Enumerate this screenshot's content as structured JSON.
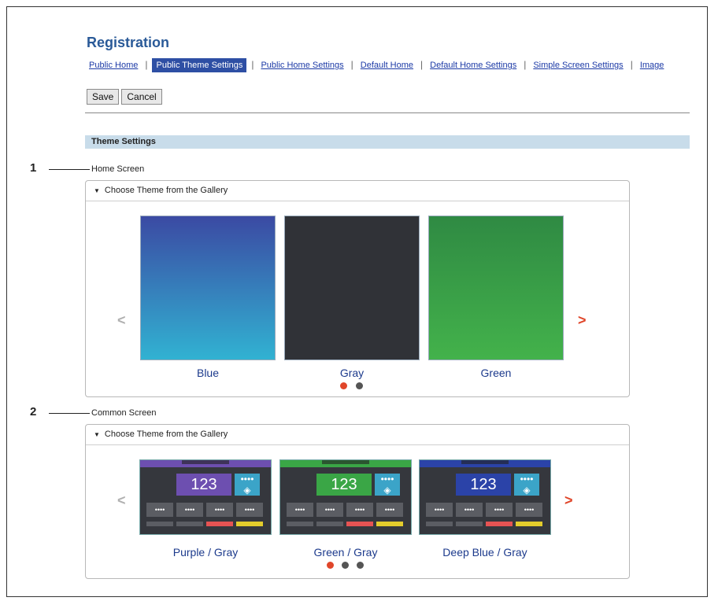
{
  "title": "Registration",
  "tabs": [
    "Public Home",
    "Public Theme Settings",
    "Public Home Settings",
    "Default Home",
    "Default Home Settings",
    "Simple Screen Settings",
    "Image"
  ],
  "buttons": {
    "save": "Save",
    "cancel": "Cancel"
  },
  "section_title": "Theme Settings",
  "callouts": [
    "1",
    "2"
  ],
  "home": {
    "label": "Home Screen",
    "panel_title": "Choose Theme from the Gallery",
    "themes": [
      {
        "name": "Blue",
        "color_top": "#3b4aa3",
        "color_bottom": "#31b2d2"
      },
      {
        "name": "Gray",
        "color_top": "#303237",
        "color_bottom": "#303237"
      },
      {
        "name": "Green",
        "color_top": "#2f8a43",
        "color_bottom": "#43b24b"
      }
    ]
  },
  "common": {
    "label": "Common Screen",
    "panel_title": "Choose Theme from the Gallery",
    "themes": [
      {
        "name": "Purple / Gray",
        "accent": "#6d4fb0",
        "number": "123"
      },
      {
        "name": "Green / Gray",
        "accent": "#3aa646",
        "number": "123"
      },
      {
        "name": "Deep Blue / Gray",
        "accent": "#2b43a8",
        "number": "123"
      }
    ]
  },
  "nav": {
    "prev": "<",
    "next": ">"
  },
  "key_dots": "••••",
  "colors": {
    "link": "#1c3aa6",
    "active_tab": "#2e4fa4",
    "section_bar": "#c8dcea",
    "dot_active": "#e0462a",
    "dot_inactive": "#555555"
  }
}
